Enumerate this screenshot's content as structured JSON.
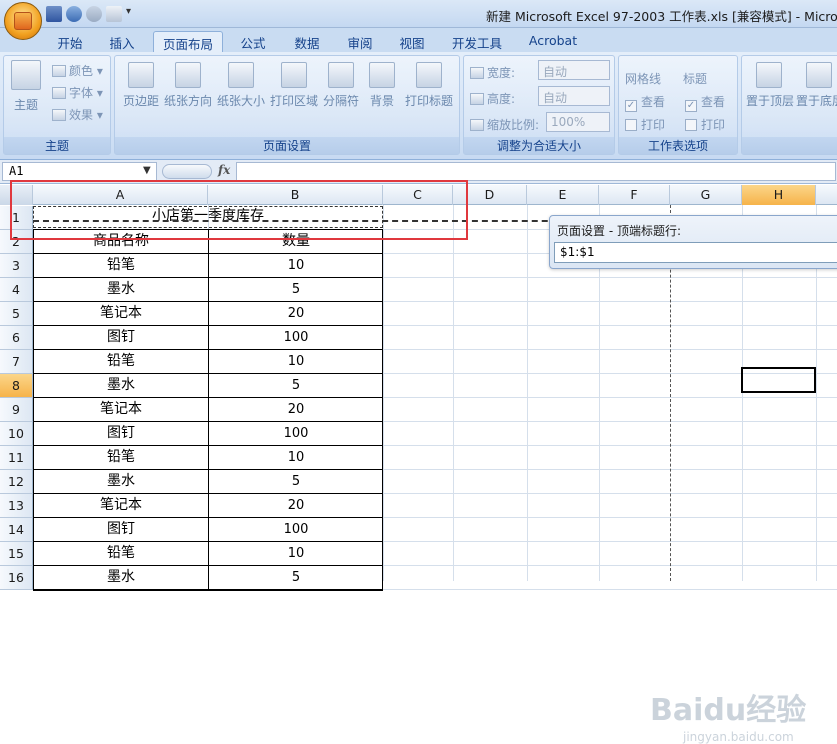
{
  "window": {
    "title": "新建 Microsoft Excel 97-2003 工作表.xls  [兼容模式] - Microso"
  },
  "tabs": [
    "开始",
    "插入",
    "页面布局",
    "公式",
    "数据",
    "审阅",
    "视图",
    "开发工具",
    "Acrobat"
  ],
  "ribbon": {
    "theme_group": {
      "label": "主题",
      "main_button": "主题",
      "colors": "颜色",
      "fonts": "字体",
      "effects": "效果"
    },
    "page_setup_group": {
      "label": "页面设置",
      "buttons": [
        "页边距",
        "纸张方向",
        "纸张大小",
        "打印区域",
        "分隔符",
        "背景",
        "打印标题"
      ]
    },
    "scale_group": {
      "label": "调整为合适大小",
      "width_label": "宽度:",
      "width_value": "自动",
      "height_label": "高度:",
      "height_value": "自动",
      "scale_label": "缩放比例:",
      "scale_value": "100%"
    },
    "sheet_options_group": {
      "label": "工作表选项",
      "gridlines": "网格线",
      "headings": "标题",
      "view": "查看",
      "print": "打印"
    },
    "arrange_group": {
      "buttons": [
        "置于顶层",
        "置于底层"
      ]
    }
  },
  "formula_bar": {
    "name_box": "A1",
    "fx": "fx",
    "content": ""
  },
  "columns": [
    "A",
    "B",
    "C",
    "D",
    "E",
    "F",
    "G",
    "H"
  ],
  "rows": [
    "1",
    "2",
    "3",
    "4",
    "5",
    "6",
    "7",
    "8",
    "9",
    "10",
    "11",
    "12",
    "13",
    "14",
    "15",
    "16"
  ],
  "sheet": {
    "title": "小店第一季度库存",
    "header": [
      "商品名称",
      "数量"
    ],
    "data": [
      [
        "铅笔",
        "10"
      ],
      [
        "墨水",
        "5"
      ],
      [
        "笔记本",
        "20"
      ],
      [
        "图钉",
        "100"
      ],
      [
        "铅笔",
        "10"
      ],
      [
        "墨水",
        "5"
      ],
      [
        "笔记本",
        "20"
      ],
      [
        "图钉",
        "100"
      ],
      [
        "铅笔",
        "10"
      ],
      [
        "墨水",
        "5"
      ],
      [
        "笔记本",
        "20"
      ],
      [
        "图钉",
        "100"
      ],
      [
        "铅笔",
        "10"
      ],
      [
        "墨水",
        "5"
      ]
    ]
  },
  "dialog": {
    "title": "页面设置 - 顶端标题行:",
    "value": "$1:$1"
  },
  "watermark": {
    "brand": "Baidu经验",
    "url": "jingyan.baidu.com"
  },
  "colors": {
    "selection_header": "#f6b34a",
    "highlight_box": "#e0383e"
  }
}
